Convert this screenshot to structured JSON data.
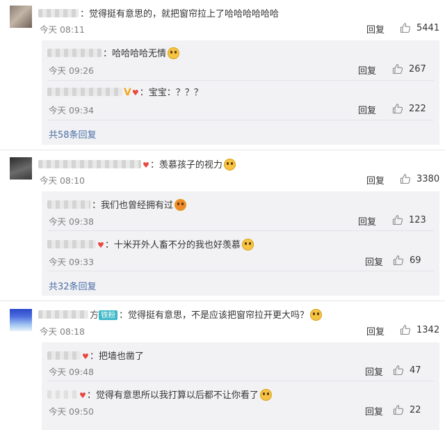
{
  "like_icon": "thumbs-up-icon",
  "colors": {
    "link": "#4a6fa5",
    "text": "#333333",
    "meta": "#808080",
    "subbox_bg": "#f2f2f5",
    "fan_badge": "#3fb8c8"
  },
  "reply_label": "回复",
  "threads": [
    {
      "text": "：觉得挺有意思的，就把窗帘拉上了哈哈哈哈哈哈",
      "time": "今天 08:11",
      "likes": "5441",
      "replies": [
        {
          "text": "：哈哈哈哈无情",
          "emoji": "cat-emoji",
          "time": "今天 09:26",
          "likes": "267"
        },
        {
          "text": "：宝宝：？？？",
          "badges": [
            "V",
            "heart"
          ],
          "time": "今天 09:34",
          "likes": "222"
        }
      ],
      "more": "共58条回复"
    },
    {
      "text": "：羡慕孩子的视力",
      "emoji": "laughing-tears-emoji",
      "time": "今天 08:10",
      "likes": "3380",
      "replies": [
        {
          "text": "：我们也曾经拥有过",
          "emoji": "laugh-emoji",
          "time": "今天 09:38",
          "likes": "123"
        },
        {
          "text": "：十米开外人畜不分的我也好羡慕",
          "emoji": "crying-emoji",
          "time": "今天 09:33",
          "likes": "69"
        }
      ],
      "more": "共32条回复"
    },
    {
      "name_tail": "方",
      "badge": "铁粉",
      "text": "：觉得挺有意思，不是应该把窗帘拉开更大吗？",
      "emoji": "cat-emoji",
      "time": "今天 08:18",
      "likes": "1342",
      "replies": [
        {
          "text": "：把墙也凿了",
          "time": "今天 09:48",
          "likes": "47"
        },
        {
          "text": "：觉得有意思所以我打算以后都不让你看了",
          "emoji": "cat-emoji",
          "time": "今天 09:50",
          "likes": "22"
        }
      ]
    }
  ]
}
